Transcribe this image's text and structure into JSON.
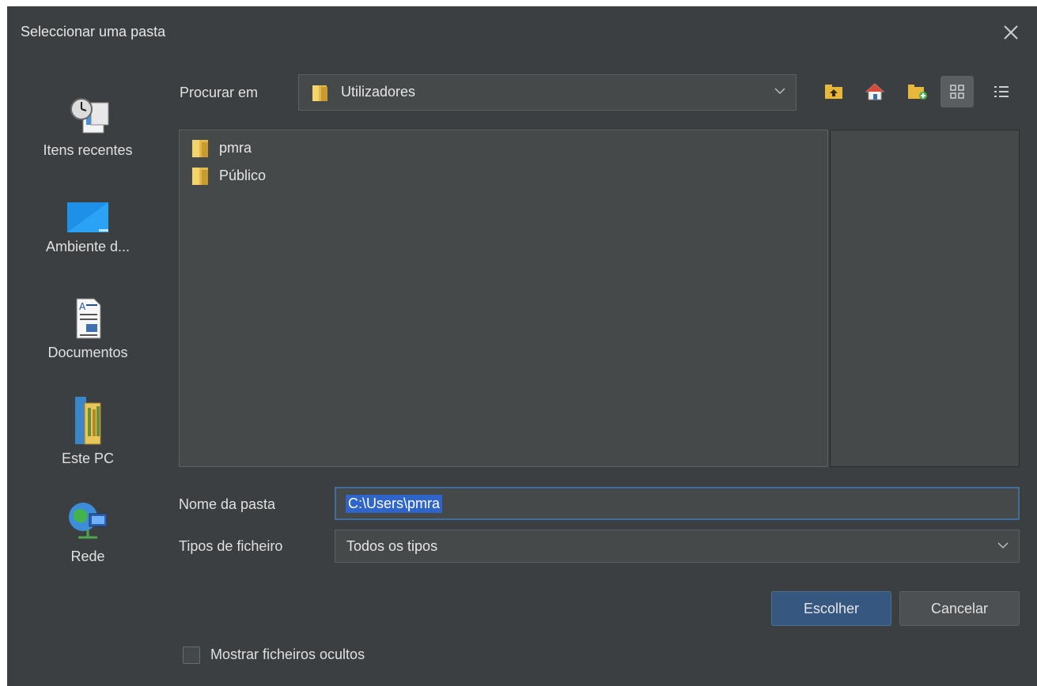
{
  "dialog": {
    "title": "Seleccionar uma pasta"
  },
  "sidebar": {
    "items": [
      {
        "label": "Itens recentes",
        "icon": "recent-items-icon"
      },
      {
        "label": "Ambiente d...",
        "icon": "desktop-icon"
      },
      {
        "label": "Documentos",
        "icon": "documents-icon"
      },
      {
        "label": "Este PC",
        "icon": "computer-icon"
      },
      {
        "label": "Rede",
        "icon": "network-icon"
      }
    ]
  },
  "lookin": {
    "label": "Procurar em",
    "value": "Utilizadores"
  },
  "toolbar": {
    "buttons": [
      "up-folder-icon",
      "home-icon",
      "new-folder-icon",
      "grid-view-icon",
      "list-view-icon"
    ]
  },
  "files": [
    {
      "name": "pmra"
    },
    {
      "name": "Público"
    }
  ],
  "folder_name": {
    "label": "Nome da pasta",
    "value": "C:\\Users\\pmra"
  },
  "file_types": {
    "label": "Tipos de ficheiro",
    "value": "Todos os tipos"
  },
  "actions": {
    "choose": "Escolher",
    "cancel": "Cancelar"
  },
  "show_hidden": {
    "label": "Mostrar ficheiros ocultos",
    "checked": false
  },
  "colors": {
    "background": "#3c3f41",
    "panel": "#45494a",
    "accent": "#365880",
    "selection": "#2f65ca"
  }
}
